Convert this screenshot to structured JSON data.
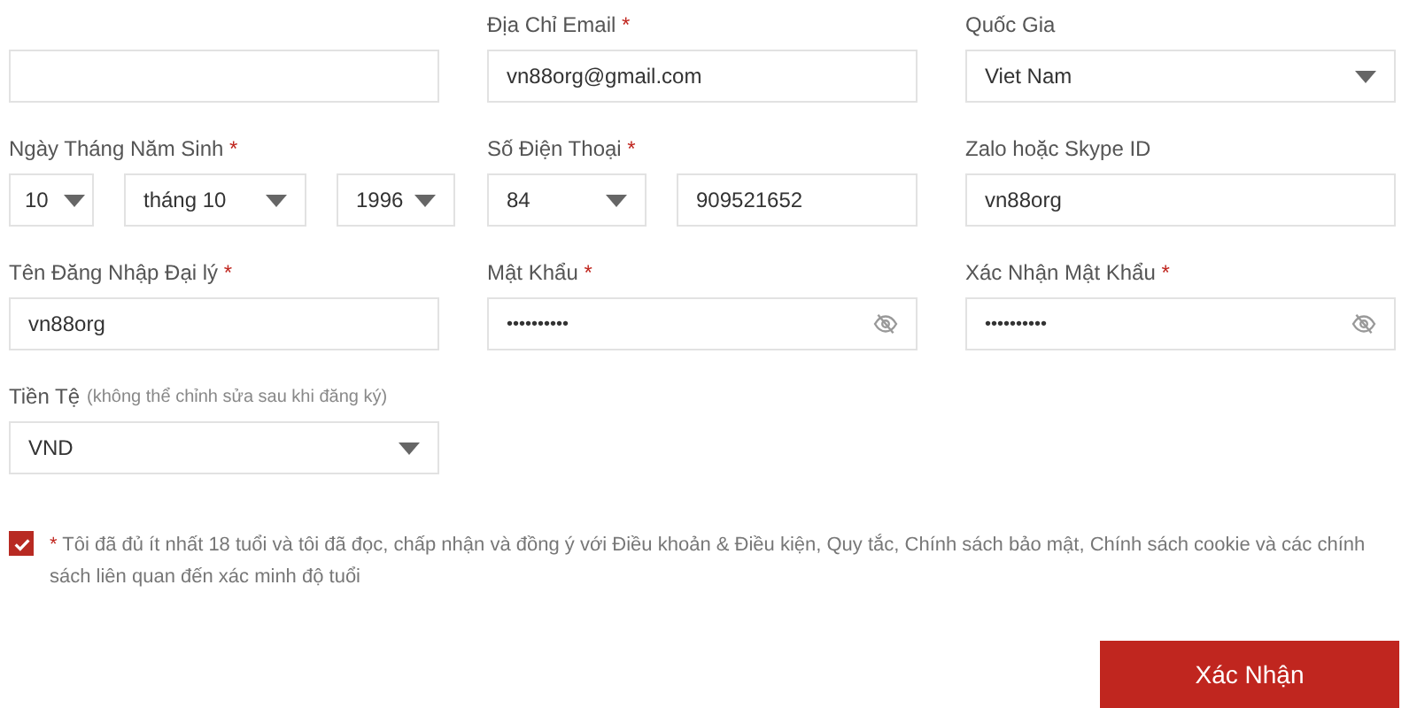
{
  "fields": [
    {
      "controls": [
        {
          "kind": "text"
        }
      ]
    },
    {
      "label": "Địa Chỉ Email",
      "required_mark": "*",
      "controls": [
        {
          "kind": "text",
          "value": "vn88org@gmail.com"
        }
      ]
    },
    {
      "label": "Quốc Gia",
      "controls": [
        {
          "kind": "select",
          "value": "Viet Nam"
        }
      ]
    },
    {
      "label": "Ngày Tháng Năm Sinh",
      "required_mark": "*",
      "controls": [
        {
          "kind": "select",
          "value": "10"
        },
        {
          "kind": "select",
          "value": "tháng 10"
        },
        {
          "kind": "select",
          "value": "1996"
        }
      ]
    },
    {
      "label": "Số Điện Thoại",
      "required_mark": "*",
      "controls": [
        {
          "kind": "select",
          "value": "84"
        },
        {
          "kind": "text",
          "value": "909521652"
        }
      ]
    },
    {
      "label": "Zalo hoặc Skype ID",
      "controls": [
        {
          "kind": "text",
          "value": "vn88org"
        }
      ]
    },
    {
      "label": "Tên Đăng Nhập Đại lý",
      "required_mark": "*",
      "controls": [
        {
          "kind": "text",
          "value": "vn88org"
        }
      ]
    },
    {
      "label": "Mật Khẩu",
      "required_mark": "*",
      "controls": [
        {
          "kind": "password",
          "value": "••••••••••"
        }
      ]
    },
    {
      "label": "Xác Nhận Mật Khẩu",
      "required_mark": "*",
      "controls": [
        {
          "kind": "password",
          "value": "••••••••••"
        }
      ]
    },
    {
      "label": "Tiền Tệ",
      "note": "(không thể chỉnh sửa sau khi đăng ký)",
      "controls": [
        {
          "kind": "select",
          "value": "VND"
        }
      ]
    }
  ],
  "agreement": {
    "checked": true,
    "mark": "*",
    "text": "Tôi đã đủ ít nhất 18 tuổi và tôi đã đọc, chấp nhận và đồng ý với Điều khoản & Điều kiện, Quy tắc, Chính sách bảo mật, Chính sách cookie và các chính sách liên quan đến xác minh độ tuổi"
  },
  "submit": "Xác Nhận"
}
